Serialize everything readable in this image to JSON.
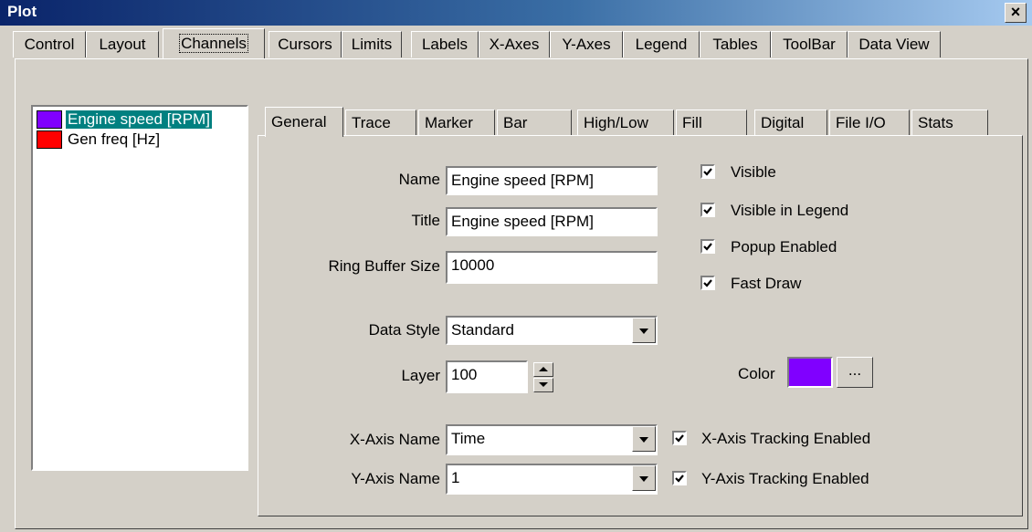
{
  "window": {
    "title": "Plot",
    "close_glyph": "×"
  },
  "outer_tabs": [
    {
      "label": "Control"
    },
    {
      "label": "Layout"
    },
    {
      "label": "Channels"
    },
    {
      "label": "Cursors"
    },
    {
      "label": "Limits"
    },
    {
      "label": "Labels"
    },
    {
      "label": "X-Axes"
    },
    {
      "label": "Y-Axes"
    },
    {
      "label": "Legend"
    },
    {
      "label": "Tables"
    },
    {
      "label": "ToolBar"
    },
    {
      "label": "Data View"
    }
  ],
  "outer_tabs_active": "Channels",
  "channels": [
    {
      "label": "Engine speed [RPM]",
      "color": "#8000ff",
      "selected": true
    },
    {
      "label": "Gen freq [Hz]",
      "color": "#ff0000",
      "selected": false
    }
  ],
  "inner_tabs": [
    {
      "label": "General"
    },
    {
      "label": "Trace"
    },
    {
      "label": "Marker"
    },
    {
      "label": "Bar"
    },
    {
      "label": "High/Low"
    },
    {
      "label": "Fill"
    },
    {
      "label": "Digital"
    },
    {
      "label": "File I/O"
    },
    {
      "label": "Stats"
    }
  ],
  "inner_tabs_active": "General",
  "general": {
    "name_label": "Name",
    "name_value": "Engine speed [RPM]",
    "title_label": "Title",
    "title_value": "Engine speed [RPM]",
    "ring_label": "Ring Buffer Size",
    "ring_value": "10000",
    "data_style_label": "Data Style",
    "data_style_value": "Standard",
    "layer_label": "Layer",
    "layer_value": "100",
    "x_axis_label": "X-Axis Name",
    "x_axis_value": "Time",
    "y_axis_label": "Y-Axis Name",
    "y_axis_value": "1",
    "color_label": "Color",
    "color_value": "#8000ff",
    "color_button": "...",
    "checkboxes": {
      "visible": {
        "label": "Visible",
        "checked": true
      },
      "visible_in_legend": {
        "label": "Visible in Legend",
        "checked": true
      },
      "popup_enabled": {
        "label": "Popup Enabled",
        "checked": true
      },
      "fast_draw": {
        "label": "Fast Draw",
        "checked": true
      },
      "x_axis_tracking": {
        "label": "X-Axis Tracking Enabled",
        "checked": true
      },
      "y_axis_tracking": {
        "label": "Y-Axis Tracking Enabled",
        "checked": true
      }
    }
  }
}
